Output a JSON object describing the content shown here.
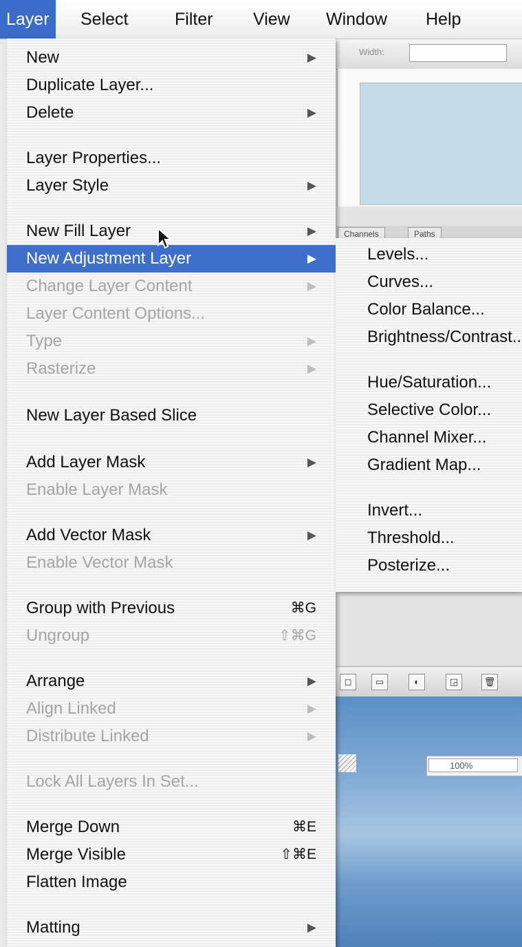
{
  "menubar": {
    "items": [
      "Layer",
      "Select",
      "Filter",
      "View",
      "Window",
      "Help"
    ],
    "active": "Layer"
  },
  "options_bar": {
    "width_label": "Width:"
  },
  "layers_palette": {
    "tabs": [
      "Channels",
      "Paths"
    ]
  },
  "status": {
    "zoom": "100%"
  },
  "layer_menu": [
    {
      "label": "New",
      "submenu": true
    },
    {
      "label": "Duplicate Layer..."
    },
    {
      "label": "Delete",
      "submenu": true
    },
    {
      "label": "Layer Properties..."
    },
    {
      "label": "Layer Style",
      "submenu": true
    },
    {
      "label": "New Fill Layer",
      "submenu": true
    },
    {
      "label": "New Adjustment Layer",
      "submenu": true,
      "highlighted": true
    },
    {
      "label": "Change Layer Content",
      "submenu": true,
      "disabled": true
    },
    {
      "label": "Layer Content Options...",
      "disabled": true
    },
    {
      "label": "Type",
      "submenu": true,
      "disabled": true
    },
    {
      "label": "Rasterize",
      "submenu": true,
      "disabled": true
    },
    {
      "label": "New Layer Based Slice"
    },
    {
      "label": "Add Layer Mask",
      "submenu": true
    },
    {
      "label": "Enable Layer Mask",
      "disabled": true
    },
    {
      "label": "Add Vector Mask",
      "submenu": true
    },
    {
      "label": "Enable Vector Mask",
      "disabled": true
    },
    {
      "label": "Group with Previous",
      "shortcut": "⌘G"
    },
    {
      "label": "Ungroup",
      "shortcut": "⇧⌘G",
      "disabled": true
    },
    {
      "label": "Arrange",
      "submenu": true
    },
    {
      "label": "Align Linked",
      "submenu": true,
      "disabled": true
    },
    {
      "label": "Distribute Linked",
      "submenu": true,
      "disabled": true
    },
    {
      "label": "Lock All Layers In Set...",
      "disabled": true
    },
    {
      "label": "Merge Down",
      "shortcut": "⌘E"
    },
    {
      "label": "Merge Visible",
      "shortcut": "⇧⌘E"
    },
    {
      "label": "Flatten Image"
    },
    {
      "label": "Matting",
      "submenu": true
    }
  ],
  "adjustment_submenu": [
    {
      "label": "Levels..."
    },
    {
      "label": "Curves..."
    },
    {
      "label": "Color Balance..."
    },
    {
      "label": "Brightness/Contrast..."
    },
    {
      "label": "Hue/Saturation..."
    },
    {
      "label": "Selective Color..."
    },
    {
      "label": "Channel Mixer..."
    },
    {
      "label": "Gradient Map..."
    },
    {
      "label": "Invert..."
    },
    {
      "label": "Threshold..."
    },
    {
      "label": "Posterize..."
    }
  ],
  "colors": {
    "highlight": "#3f6fcb",
    "menu_background": "#f1f1f1",
    "disabled_text": "#a5a5a5"
  }
}
